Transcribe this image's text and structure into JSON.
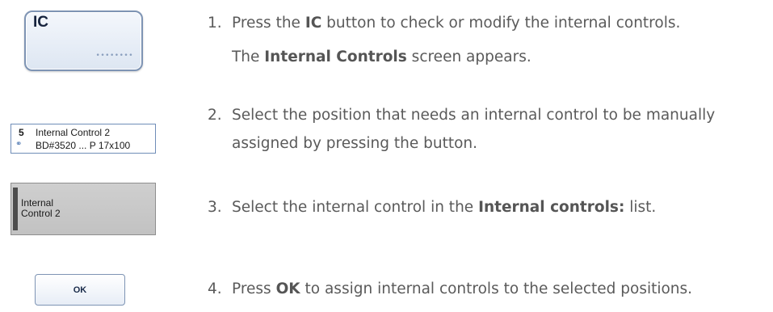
{
  "buttons": {
    "ic": {
      "label": "IC",
      "dots": "••••••••"
    },
    "position": {
      "number": "5",
      "name": "Internal Control 2",
      "icon": "link-icon",
      "code": "BD#3520 ... P 17x100"
    },
    "list_item": {
      "label": "Internal\nControl 2"
    },
    "ok": {
      "label": "OK"
    }
  },
  "steps": [
    {
      "num": "1.",
      "pre": "Press the ",
      "bold": "IC",
      "post": " button to check or modify the internal controls."
    },
    {
      "pre": "The ",
      "bold": "Internal Controls",
      "post": " screen appears."
    },
    {
      "num": "2.",
      "text": "Select the position that needs an internal control to be manually"
    },
    {
      "text": "assigned by pressing the button."
    },
    {
      "num": "3.",
      "pre": "Select the internal control in the ",
      "bold": "Internal controls:",
      "post": " list."
    },
    {
      "num": "4.",
      "pre": "Press ",
      "bold": "OK",
      "post": " to assign internal controls to the selected positions."
    }
  ],
  "colors": {
    "text": "#5a5a5a",
    "button_border": "#7e94b4",
    "list_bg": "#c8c8c8"
  }
}
